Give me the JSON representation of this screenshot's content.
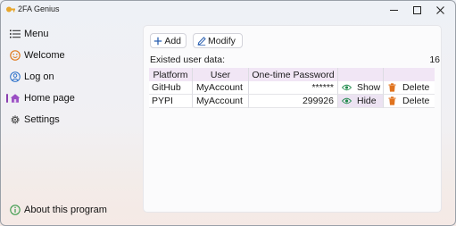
{
  "window": {
    "title": "2FA Genius",
    "controls": [
      "minimize",
      "maximize",
      "close"
    ]
  },
  "sidebar": {
    "items": [
      {
        "label": "Menu",
        "icon": "menu-icon"
      },
      {
        "label": "Welcome",
        "icon": "smiley-icon"
      },
      {
        "label": "Log on",
        "icon": "user-icon"
      },
      {
        "label": "Home page",
        "icon": "home-icon",
        "selected": true
      },
      {
        "label": "Settings",
        "icon": "gear-icon"
      }
    ],
    "footer": {
      "label": "About this program",
      "icon": "info-icon"
    }
  },
  "toolbar": {
    "add_label": "Add",
    "modify_label": "Modify"
  },
  "data_info": {
    "label": "Existed user data:",
    "count": "16"
  },
  "table": {
    "columns": [
      "Platform",
      "User",
      "One-time Password"
    ],
    "rows": [
      {
        "platform": "GitHub",
        "user": "MyAccount",
        "password": "******",
        "toggle_label": "Show",
        "delete_label": "Delete"
      },
      {
        "platform": "PYPI",
        "user": "MyAccount",
        "password": "299926",
        "toggle_label": "Hide",
        "delete_label": "Delete"
      }
    ]
  },
  "colors": {
    "accent": "#8a3fb0",
    "header_bg": "#f1e6f5",
    "delete_icon": "#e0731f",
    "eye_icon": "#1f8a4c"
  }
}
